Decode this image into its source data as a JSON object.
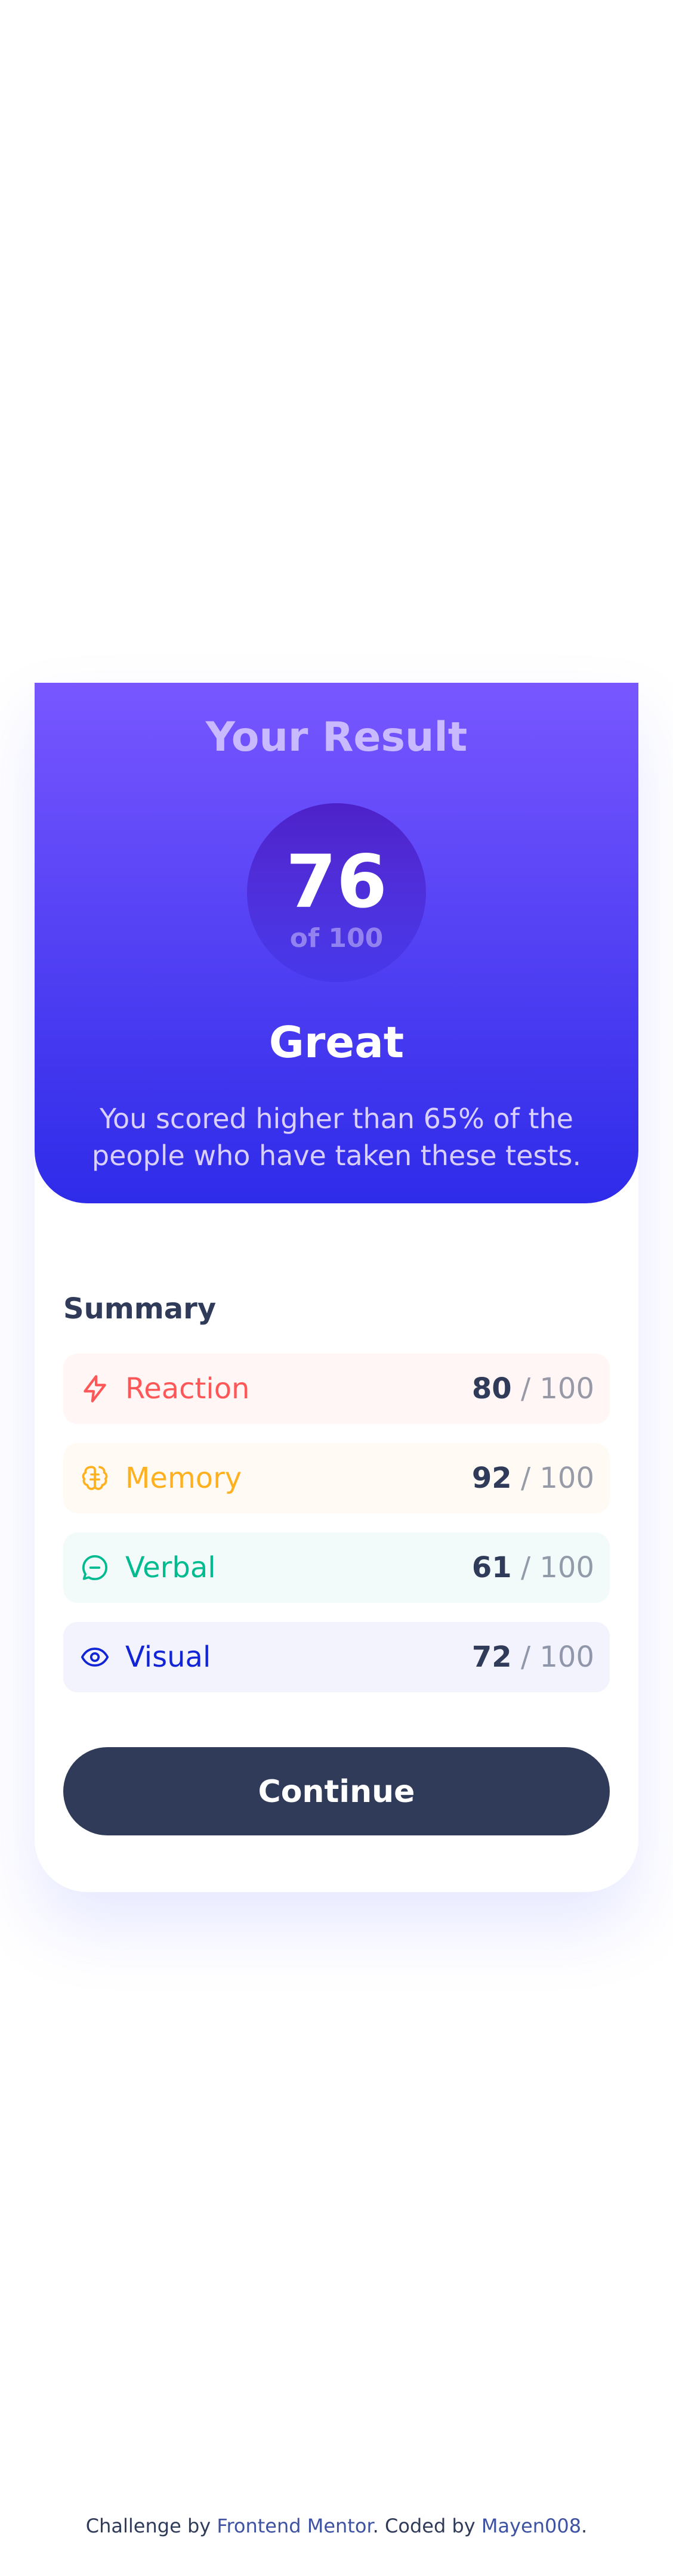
{
  "result": {
    "title": "Your Result",
    "score": "76",
    "score_total": "of 100",
    "grade": "Great",
    "message": "You scored higher than 65% of the people who have taken these tests."
  },
  "summary": {
    "title": "Summary",
    "items": [
      {
        "label": "Reaction",
        "score": "80",
        "separator": "/",
        "max": "100",
        "icon": "lightning-icon",
        "color": "#ff5757",
        "background": "#fff6f5"
      },
      {
        "label": "Memory",
        "score": "92",
        "separator": "/",
        "max": "100",
        "icon": "brain-icon",
        "color": "#ffb01f",
        "background": "#fffbf4"
      },
      {
        "label": "Verbal",
        "score": "61",
        "separator": "/",
        "max": "100",
        "icon": "speech-bubble-icon",
        "color": "#00bb8f",
        "background": "#f2fbfa"
      },
      {
        "label": "Visual",
        "score": "72",
        "separator": "/",
        "max": "100",
        "icon": "eye-icon",
        "color": "#1125d6",
        "background": "#f3f3fd"
      }
    ],
    "continue_label": "Continue"
  },
  "attribution": {
    "prefix": "Challenge by",
    "challenge_link": "Frontend Mentor",
    "middle": ". Coded by",
    "author_link": "Mayen008",
    "suffix": "."
  },
  "colors": {
    "gradient_top": "#7857ff",
    "gradient_bottom": "#2e2be9",
    "button": "#303b59"
  }
}
